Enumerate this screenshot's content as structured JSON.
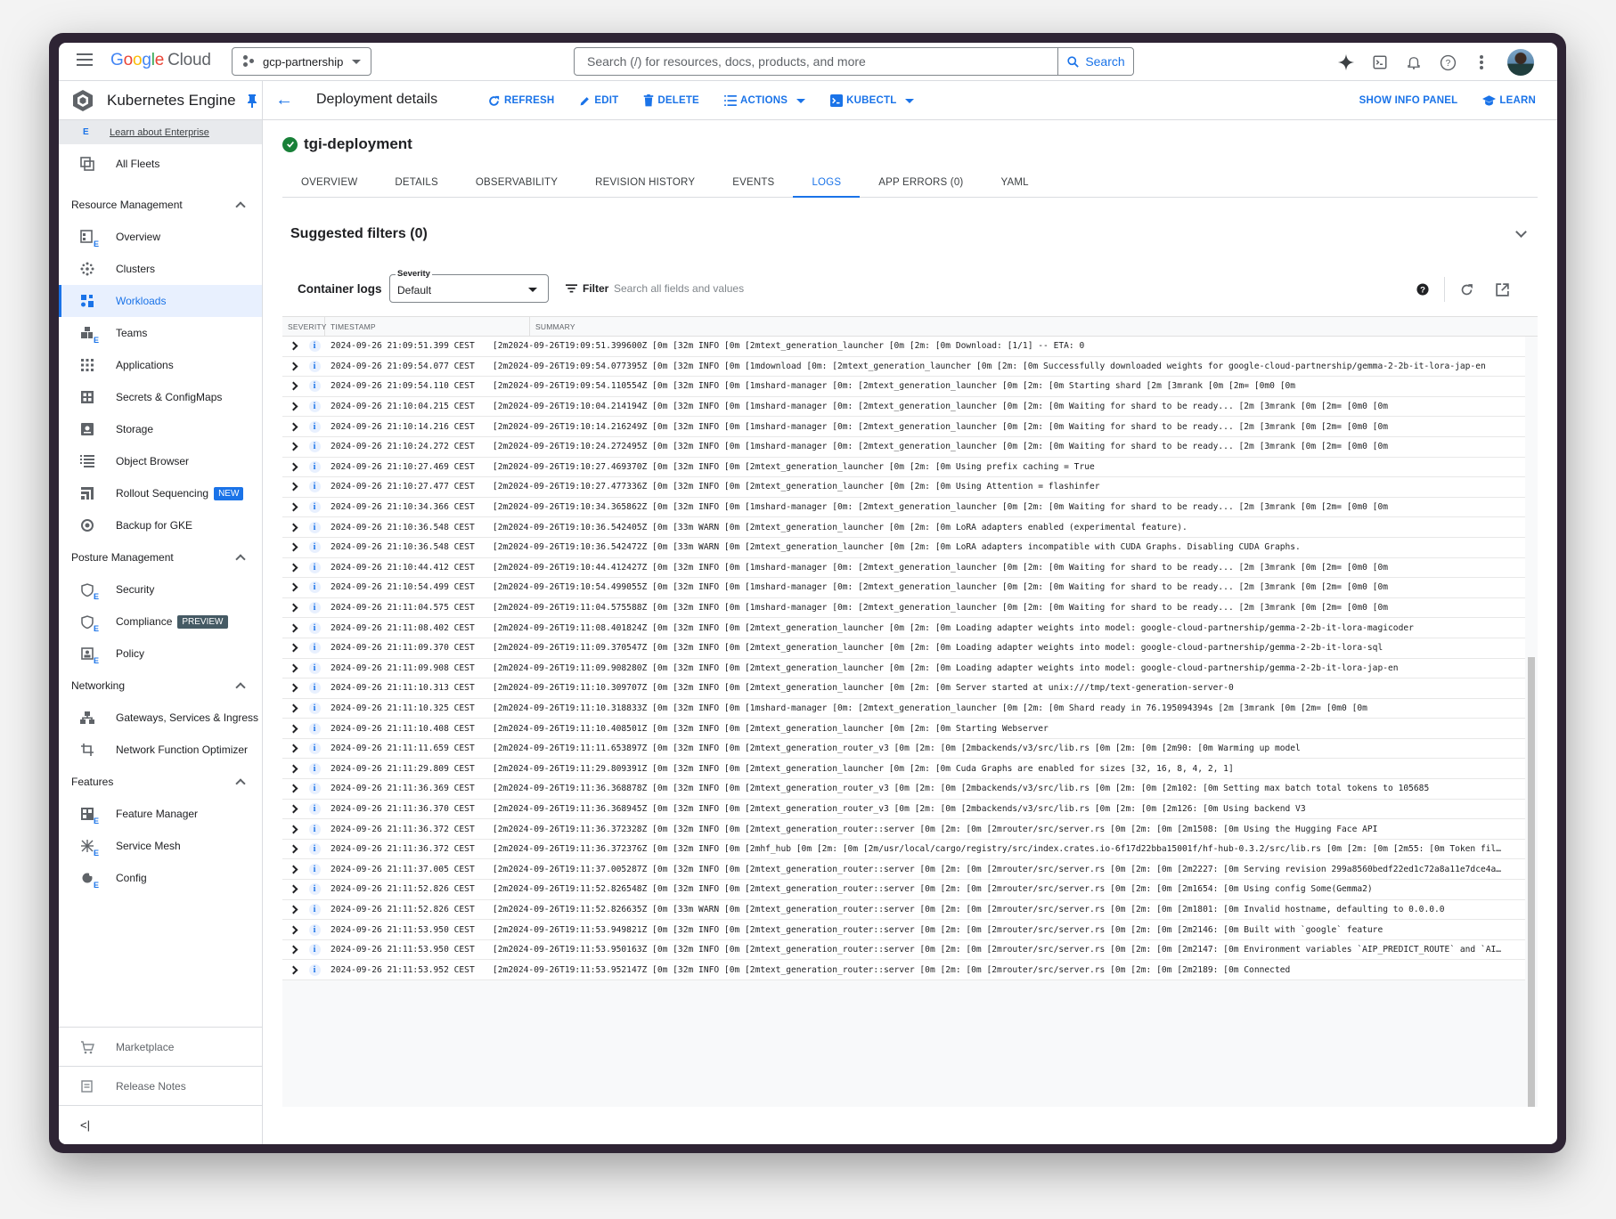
{
  "topbar": {
    "logo": {
      "g": "G",
      "o1": "o",
      "o2": "o",
      "g2": "g",
      "l": "l",
      "e": "e",
      "cloud": "Cloud"
    },
    "project": "gcp-partnership",
    "search_placeholder": "Search (/) for resources, docs, products, and more",
    "search_button": "Search",
    "icons": [
      "gemini-icon",
      "cloud-shell-icon",
      "notifications-icon",
      "help-icon",
      "more-vert-icon",
      "avatar"
    ]
  },
  "sidebar": {
    "product": "Kubernetes Engine",
    "enterprise_link": "Learn about Enterprise",
    "all_fleets": "All Fleets",
    "sections": [
      {
        "title": "Resource Management",
        "items": [
          {
            "label": "Overview",
            "icon": "overview-icon"
          },
          {
            "label": "Clusters",
            "icon": "clusters-icon"
          },
          {
            "label": "Workloads",
            "icon": "workloads-icon",
            "active": true
          },
          {
            "label": "Teams",
            "icon": "teams-icon"
          },
          {
            "label": "Applications",
            "icon": "applications-icon"
          },
          {
            "label": "Secrets & ConfigMaps",
            "icon": "secrets-icon"
          },
          {
            "label": "Storage",
            "icon": "storage-icon"
          },
          {
            "label": "Object Browser",
            "icon": "object-browser-icon"
          },
          {
            "label": "Rollout Sequencing",
            "icon": "rollout-icon",
            "badge": "NEW"
          },
          {
            "label": "Backup for GKE",
            "icon": "backup-icon"
          }
        ]
      },
      {
        "title": "Posture Management",
        "items": [
          {
            "label": "Security",
            "icon": "security-icon"
          },
          {
            "label": "Compliance",
            "icon": "compliance-icon",
            "badge": "PREVIEW"
          },
          {
            "label": "Policy",
            "icon": "policy-icon"
          }
        ]
      },
      {
        "title": "Networking",
        "items": [
          {
            "label": "Gateways, Services & Ingress",
            "icon": "gateways-icon"
          },
          {
            "label": "Network Function Optimizer",
            "icon": "network-function-icon"
          }
        ]
      },
      {
        "title": "Features",
        "items": [
          {
            "label": "Feature Manager",
            "icon": "feature-manager-icon"
          },
          {
            "label": "Service Mesh",
            "icon": "service-mesh-icon"
          },
          {
            "label": "Config",
            "icon": "config-icon"
          }
        ]
      }
    ],
    "bottom": [
      {
        "label": "Marketplace",
        "icon": "marketplace-icon"
      },
      {
        "label": "Release Notes",
        "icon": "release-notes-icon"
      }
    ],
    "collapse_label": "<|"
  },
  "actionbar": {
    "title": "Deployment details",
    "actions": [
      {
        "label": "REFRESH",
        "icon": "refresh-icon"
      },
      {
        "label": "EDIT",
        "icon": "edit-icon"
      },
      {
        "label": "DELETE",
        "icon": "delete-icon"
      },
      {
        "label": "ACTIONS",
        "icon": "actions-list-icon",
        "dropdown": true
      },
      {
        "label": "KUBECTL",
        "icon": "kubectl-icon",
        "dropdown": true
      }
    ],
    "show_info_panel": "SHOW INFO PANEL",
    "learn": "LEARN"
  },
  "deployment": {
    "name": "tgi-deployment",
    "status": "ok",
    "tabs": [
      "OVERVIEW",
      "DETAILS",
      "OBSERVABILITY",
      "REVISION HISTORY",
      "EVENTS",
      "LOGS",
      "APP ERRORS (0)",
      "YAML"
    ],
    "active_tab": "LOGS"
  },
  "suggested_filters": "Suggested filters (0)",
  "logs": {
    "title": "Container logs",
    "severity_label": "Severity",
    "severity_value": "Default",
    "filter_label": "Filter",
    "filter_placeholder": "Search all fields and values",
    "columns": [
      "SEVERITY",
      "TIMESTAMP",
      "SUMMARY"
    ],
    "rows": [
      {
        "ts": "2024-09-26 21:09:51.399 CEST",
        "summary": "[2m2024-09-26T19:09:51.399600Z [0m  [32m INFO [0m  [2mtext_generation_launcher [0m [2m: [0m Download: [1/1] -- ETA: 0"
      },
      {
        "ts": "2024-09-26 21:09:54.077 CEST",
        "summary": "[2m2024-09-26T19:09:54.077395Z [0m  [32m INFO [0m  [1mdownload [0m:  [2mtext_generation_launcher [0m [2m: [0m Successfully downloaded weights for google-cloud-partnership/gemma-2-2b-it-lora-jap-en"
      },
      {
        "ts": "2024-09-26 21:09:54.110 CEST",
        "summary": "[2m2024-09-26T19:09:54.110554Z [0m  [32m INFO [0m  [1mshard-manager [0m:  [2mtext_generation_launcher [0m [2m: [0m Starting shard  [2m [3mrank [0m [2m= [0m0 [0m"
      },
      {
        "ts": "2024-09-26 21:10:04.215 CEST",
        "summary": "[2m2024-09-26T19:10:04.214194Z [0m  [32m INFO [0m  [1mshard-manager [0m:  [2mtext_generation_launcher [0m [2m: [0m Waiting for shard to be ready...  [2m [3mrank [0m [2m= [0m0 [0m"
      },
      {
        "ts": "2024-09-26 21:10:14.216 CEST",
        "summary": "[2m2024-09-26T19:10:14.216249Z [0m  [32m INFO [0m  [1mshard-manager [0m:  [2mtext_generation_launcher [0m [2m: [0m Waiting for shard to be ready...  [2m [3mrank [0m [2m= [0m0 [0m"
      },
      {
        "ts": "2024-09-26 21:10:24.272 CEST",
        "summary": "[2m2024-09-26T19:10:24.272495Z [0m  [32m INFO [0m  [1mshard-manager [0m:  [2mtext_generation_launcher [0m [2m: [0m Waiting for shard to be ready...  [2m [3mrank [0m [2m= [0m0 [0m"
      },
      {
        "ts": "2024-09-26 21:10:27.469 CEST",
        "summary": "[2m2024-09-26T19:10:27.469370Z [0m  [32m INFO [0m  [2mtext_generation_launcher [0m [2m: [0m Using prefix caching = True"
      },
      {
        "ts": "2024-09-26 21:10:27.477 CEST",
        "summary": "[2m2024-09-26T19:10:27.477336Z [0m  [32m INFO [0m  [2mtext_generation_launcher [0m [2m: [0m Using Attention = flashinfer"
      },
      {
        "ts": "2024-09-26 21:10:34.366 CEST",
        "summary": "[2m2024-09-26T19:10:34.365862Z [0m  [32m INFO [0m  [1mshard-manager [0m:  [2mtext_generation_launcher [0m [2m: [0m Waiting for shard to be ready...  [2m [3mrank [0m [2m= [0m0 [0m"
      },
      {
        "ts": "2024-09-26 21:10:36.548 CEST",
        "summary": "[2m2024-09-26T19:10:36.542405Z [0m  [33m WARN [0m  [2mtext_generation_launcher [0m [2m: [0m LoRA adapters enabled (experimental feature)."
      },
      {
        "ts": "2024-09-26 21:10:36.548 CEST",
        "summary": "[2m2024-09-26T19:10:36.542472Z [0m  [33m WARN [0m  [2mtext_generation_launcher [0m [2m: [0m LoRA adapters incompatible with CUDA Graphs. Disabling CUDA Graphs."
      },
      {
        "ts": "2024-09-26 21:10:44.412 CEST",
        "summary": "[2m2024-09-26T19:10:44.412427Z [0m  [32m INFO [0m  [1mshard-manager [0m:  [2mtext_generation_launcher [0m [2m: [0m Waiting for shard to be ready...  [2m [3mrank [0m [2m= [0m0 [0m"
      },
      {
        "ts": "2024-09-26 21:10:54.499 CEST",
        "summary": "[2m2024-09-26T19:10:54.499055Z [0m  [32m INFO [0m  [1mshard-manager [0m:  [2mtext_generation_launcher [0m [2m: [0m Waiting for shard to be ready...  [2m [3mrank [0m [2m= [0m0 [0m"
      },
      {
        "ts": "2024-09-26 21:11:04.575 CEST",
        "summary": "[2m2024-09-26T19:11:04.575588Z [0m  [32m INFO [0m  [1mshard-manager [0m:  [2mtext_generation_launcher [0m [2m: [0m Waiting for shard to be ready...  [2m [3mrank [0m [2m= [0m0 [0m"
      },
      {
        "ts": "2024-09-26 21:11:08.402 CEST",
        "summary": "[2m2024-09-26T19:11:08.401824Z [0m  [32m INFO [0m  [2mtext_generation_launcher [0m [2m: [0m Loading adapter weights into model: google-cloud-partnership/gemma-2-2b-it-lora-magicoder"
      },
      {
        "ts": "2024-09-26 21:11:09.370 CEST",
        "summary": "[2m2024-09-26T19:11:09.370547Z [0m  [32m INFO [0m  [2mtext_generation_launcher [0m [2m: [0m Loading adapter weights into model: google-cloud-partnership/gemma-2-2b-it-lora-sql"
      },
      {
        "ts": "2024-09-26 21:11:09.908 CEST",
        "summary": "[2m2024-09-26T19:11:09.908280Z [0m  [32m INFO [0m  [2mtext_generation_launcher [0m [2m: [0m Loading adapter weights into model: google-cloud-partnership/gemma-2-2b-it-lora-jap-en"
      },
      {
        "ts": "2024-09-26 21:11:10.313 CEST",
        "summary": "[2m2024-09-26T19:11:10.309707Z [0m  [32m INFO [0m  [2mtext_generation_launcher [0m [2m: [0m Server started at unix:///tmp/text-generation-server-0"
      },
      {
        "ts": "2024-09-26 21:11:10.325 CEST",
        "summary": "[2m2024-09-26T19:11:10.318833Z [0m  [32m INFO [0m  [1mshard-manager [0m:  [2mtext_generation_launcher [0m [2m: [0m Shard ready in 76.195094394s  [2m [3mrank [0m [2m= [0m0 [0m"
      },
      {
        "ts": "2024-09-26 21:11:10.408 CEST",
        "summary": "[2m2024-09-26T19:11:10.408501Z [0m  [32m INFO [0m  [2mtext_generation_launcher [0m [2m: [0m Starting Webserver"
      },
      {
        "ts": "2024-09-26 21:11:11.659 CEST",
        "summary": "[2m2024-09-26T19:11:11.653897Z [0m  [32m INFO [0m  [2mtext_generation_router_v3 [0m [2m: [0m  [2mbackends/v3/src/lib.rs [0m [2m: [0m [2m90: [0m Warming up model"
      },
      {
        "ts": "2024-09-26 21:11:29.809 CEST",
        "summary": "[2m2024-09-26T19:11:29.809391Z [0m  [32m INFO [0m  [2mtext_generation_launcher [0m [2m: [0m Cuda Graphs are enabled for sizes [32, 16, 8, 4, 2, 1]"
      },
      {
        "ts": "2024-09-26 21:11:36.369 CEST",
        "summary": "[2m2024-09-26T19:11:36.368878Z [0m  [32m INFO [0m  [2mtext_generation_router_v3 [0m [2m: [0m  [2mbackends/v3/src/lib.rs [0m [2m: [0m [2m102: [0m Setting max batch total tokens to 105685"
      },
      {
        "ts": "2024-09-26 21:11:36.370 CEST",
        "summary": "[2m2024-09-26T19:11:36.368945Z [0m  [32m INFO [0m  [2mtext_generation_router_v3 [0m [2m: [0m  [2mbackends/v3/src/lib.rs [0m [2m: [0m [2m126: [0m Using backend V3"
      },
      {
        "ts": "2024-09-26 21:11:36.372 CEST",
        "summary": "[2m2024-09-26T19:11:36.372328Z [0m  [32m INFO [0m  [2mtext_generation_router::server [0m [2m: [0m  [2mrouter/src/server.rs [0m [2m: [0m [2m1508: [0m Using the Hugging Face API"
      },
      {
        "ts": "2024-09-26 21:11:36.372 CEST",
        "summary": "[2m2024-09-26T19:11:36.372376Z [0m  [32m INFO [0m  [2mhf_hub [0m [2m: [0m  [2m/usr/local/cargo/registry/src/index.crates.io-6f17d22bba15001f/hf-hub-0.3.2/src/lib.rs [0m [2m: [0m [2m55: [0m Token fil…"
      },
      {
        "ts": "2024-09-26 21:11:37.005 CEST",
        "summary": "[2m2024-09-26T19:11:37.005287Z [0m  [32m INFO [0m  [2mtext_generation_router::server [0m [2m: [0m  [2mrouter/src/server.rs [0m [2m: [0m [2m2227: [0m Serving revision 299a8560bedf22ed1c72a8a11e7dce4a…"
      },
      {
        "ts": "2024-09-26 21:11:52.826 CEST",
        "summary": "[2m2024-09-26T19:11:52.826548Z [0m  [32m INFO [0m  [2mtext_generation_router::server [0m [2m: [0m  [2mrouter/src/server.rs [0m [2m: [0m [2m1654: [0m Using config Some(Gemma2)"
      },
      {
        "ts": "2024-09-26 21:11:52.826 CEST",
        "summary": "[2m2024-09-26T19:11:52.826635Z [0m  [33m WARN [0m  [2mtext_generation_router::server [0m [2m: [0m  [2mrouter/src/server.rs [0m [2m: [0m [2m1801: [0m Invalid hostname, defaulting to 0.0.0.0"
      },
      {
        "ts": "2024-09-26 21:11:53.950 CEST",
        "summary": "[2m2024-09-26T19:11:53.949821Z [0m  [32m INFO [0m  [2mtext_generation_router::server [0m [2m: [0m  [2mrouter/src/server.rs [0m [2m: [0m [2m2146: [0m Built with `google` feature"
      },
      {
        "ts": "2024-09-26 21:11:53.950 CEST",
        "summary": "[2m2024-09-26T19:11:53.950163Z [0m  [32m INFO [0m  [2mtext_generation_router::server [0m [2m: [0m  [2mrouter/src/server.rs [0m [2m: [0m [2m2147: [0m Environment variables `AIP_PREDICT_ROUTE` and `AI…"
      },
      {
        "ts": "2024-09-26 21:11:53.952 CEST",
        "summary": "[2m2024-09-26T19:11:53.952147Z [0m  [32m INFO [0m  [2mtext_generation_router::server [0m [2m: [0m  [2mrouter/src/server.rs [0m [2m: [0m [2m2189: [0m Connected"
      }
    ]
  },
  "colors": {
    "accent": "#1a73e8",
    "success": "#188038",
    "new_badge": "#1a73e8",
    "preview_badge": "#455a64",
    "frame": "#2e2434"
  }
}
